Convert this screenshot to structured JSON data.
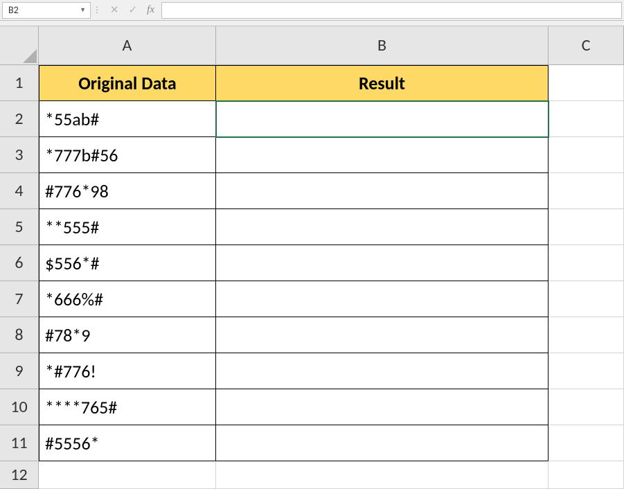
{
  "formula_bar": {
    "name_box": "B2",
    "fx_label": "fx",
    "formula_value": ""
  },
  "columns": {
    "A": "A",
    "B": "B",
    "C": "C"
  },
  "rows": [
    "1",
    "2",
    "3",
    "4",
    "5",
    "6",
    "7",
    "8",
    "9",
    "10",
    "11",
    "12"
  ],
  "headers": {
    "col_a": "Original Data",
    "col_b": "Result"
  },
  "data": {
    "col_a": [
      "*55ab#",
      "*777b#56",
      "#776*98",
      "**555#",
      "$556*#",
      "*666%#",
      "#78*9",
      "*#776!",
      "****765#",
      "#5556*"
    ],
    "col_b": [
      "",
      "",
      "",
      "",
      "",
      "",
      "",
      "",
      "",
      ""
    ]
  },
  "selected_cell": "B2"
}
